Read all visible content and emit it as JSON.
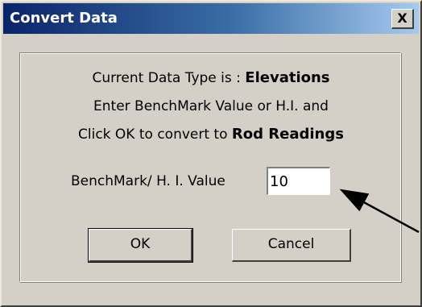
{
  "window": {
    "title": "Convert Data",
    "close_glyph": "X"
  },
  "message": {
    "line1_prefix": "Current Data Type is : ",
    "line1_value": "Elevations",
    "line2": "Enter BenchMark Value or H.I. and",
    "line3_prefix": "Click OK to convert to ",
    "line3_value": "Rod Readings"
  },
  "field": {
    "label": "BenchMark/ H. I. Value",
    "value": "10"
  },
  "buttons": {
    "ok": "OK",
    "cancel": "Cancel"
  },
  "annotation": {
    "arrow_color": "#000000"
  },
  "colors": {
    "titlebar_start": "#0a246a",
    "titlebar_end": "#a6caf0",
    "dialog_bg": "#d4d0c8"
  }
}
